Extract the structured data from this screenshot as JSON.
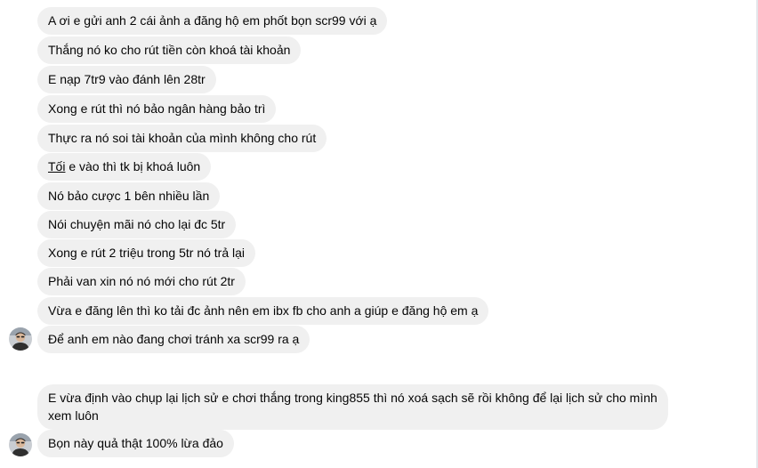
{
  "messages": [
    {
      "text": "A ơi e gửi anh 2 cái ảnh a đăng hộ em phốt bọn scr99 với ạ"
    },
    {
      "text": "Thắng nó ko cho rút tiền còn khoá tài khoản"
    },
    {
      "text": "E nạp 7tr9 vào đánh lên 28tr"
    },
    {
      "text": "Xong e rút thì nó bảo ngân hàng bảo trì"
    },
    {
      "text": "Thực ra nó soi tài khoản của mình không cho rút"
    },
    {
      "first_word": "Tối",
      "rest": " e vào thì tk bị khoá luôn"
    },
    {
      "text": "Nó bảo cược 1 bên nhiều lần"
    },
    {
      "text": "Nói chuyện mãi nó cho lại đc 5tr"
    },
    {
      "text": "Xong e rút 2 triệu trong 5tr nó trả lại"
    },
    {
      "text": "Phải van xin nó nó mới cho rút 2tr"
    },
    {
      "text": "Vừa e đăng lên thì ko tải đc ảnh nên em ibx fb cho anh a giúp e đăng hộ em ạ"
    },
    {
      "text": "Để anh em nào đang chơi tránh xa scr99 ra ạ"
    },
    {
      "text": "E vừa định vào chụp lại lịch sử e chơi thắng trong king855 thì nó xoá sạch sẽ rồi không để lại lịch sử cho mình xem luôn"
    },
    {
      "text": "Bọn này quả thật 100% lừa đảo"
    }
  ],
  "colors": {
    "bubble_bg": "#f0f0f0",
    "text": "#050505",
    "page_bg": "#ffffff"
  },
  "icons": {
    "avatar": "sender-avatar-photo"
  }
}
